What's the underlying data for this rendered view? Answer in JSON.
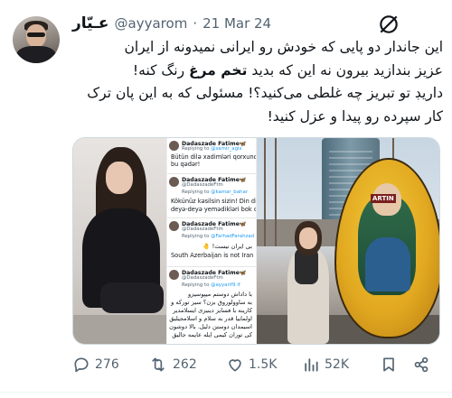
{
  "tweet": {
    "display_name": "عـيّار",
    "handle": "@ayyarom",
    "separator": "·",
    "date": "21 Mar 24",
    "lines": [
      "این جاندار دو پایی که خودش رو ایرانی نمیدونه از ایران",
      "عزیز بندازید بیرون نه این که بدید",
      "داریڊ تو تبریز چه غلطی می‌کنید؟! مسئولی که به این پان ترک",
      "کار سپرده رو پیدا و عزل کنید!"
    ],
    "line2_bold_1": "تخم مرغ",
    "line2_end": " رنگ کنه!"
  },
  "screenshot": {
    "c1_name": "Dadaszade Fatime🦋",
    "c1_replying": "@samir_agis",
    "c1_body_1": "Bütün dilə xadimləri qorxunc və",
    "c1_body_2": "bu qədər!",
    "c2_name": "Dadaszade Fatime🦋",
    "c2_handle": "@DadaszadeFtm",
    "c2_replying": "@kamar_bahar",
    "c2_body_1": "Kökünüz kəsilsin sizin! Din din",
    "c2_body_2": "deyə-deyə yemədikləri bok ca",
    "c3_name": "Dadaszade Fatime🦋",
    "c3_handle": "@DadaszadeFtm",
    "c3_replying": "@FarhadFarahzad",
    "c3_body_1": "بی ایران نیست! 🤚",
    "c3_body_2": "South Azerbaijan is not Iran",
    "c4_name": "Dadaszade Fatime🦋",
    "c4_handle": "@DadaszadeFtm",
    "c4_replying": "@ayyarif9 if",
    "c4_body_1": "با داداش دوستم میپوسیزو",
    "c4_body_2": "به ساوولوروق بزن؟ سیز تورکه و",
    "c4_body_3": "کارینه با فسایز دینیزی ایسلامدیر",
    "c4_body_4": "اولماییا قدر به سلام و اسلامجیلیق",
    "c4_body_5": "اسیمدان دوستن دلیل. بالا دوشون",
    "c4_body_6": "کی توران کیمی ایله عایمه جالیق"
  },
  "egg_sign": "ARTIN",
  "actions": {
    "replies": "276",
    "reposts": "262",
    "likes": "1.5K",
    "views": "52K"
  },
  "colors": {
    "text": "#0f1419",
    "muted": "#536471",
    "link": "#1d9bf0",
    "border": "#cfd9de"
  },
  "icons": [
    "grok-icon",
    "reply-icon",
    "repost-icon",
    "like-icon",
    "views-icon",
    "bookmark-icon",
    "share-icon"
  ]
}
